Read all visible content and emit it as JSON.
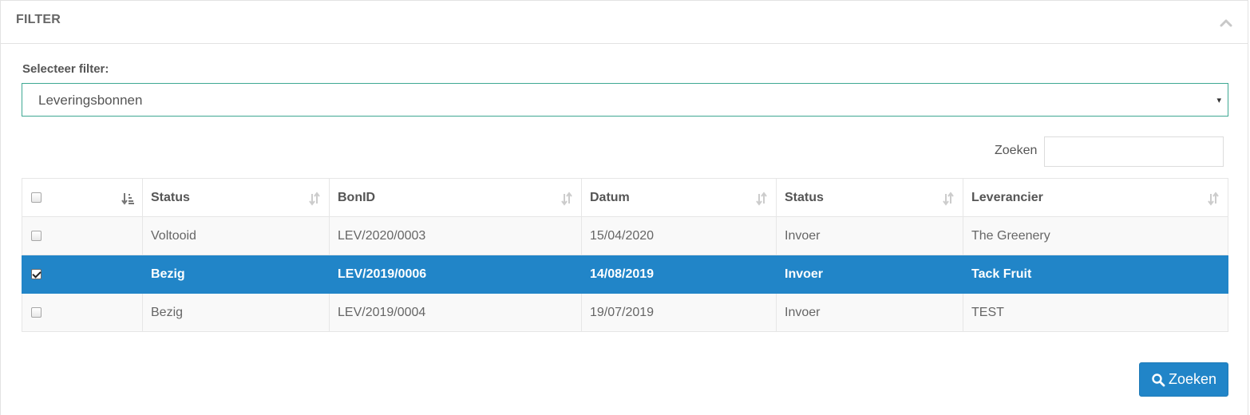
{
  "panel": {
    "title": "FILTER",
    "collapse_icon": "chevron-up-icon"
  },
  "filter": {
    "label": "Selecteer filter:",
    "selected": "Leveringsbonnen",
    "arrow": "▾"
  },
  "search": {
    "label": "Zoeken",
    "value": "",
    "placeholder": ""
  },
  "table": {
    "columns": [
      "",
      "Status",
      "BonID",
      "Datum",
      "Status",
      "Leverancier"
    ],
    "rows": [
      {
        "checked": false,
        "cells": [
          "Voltooid",
          "LEV/2020/0003",
          "15/04/2020",
          "Invoer",
          "The Greenery"
        ]
      },
      {
        "checked": true,
        "cells": [
          "Bezig",
          "LEV/2019/0006",
          "14/08/2019",
          "Invoer",
          "Tack Fruit"
        ]
      },
      {
        "checked": false,
        "cells": [
          "Bezig",
          "LEV/2019/0004",
          "19/07/2019",
          "Invoer",
          "TEST"
        ]
      }
    ]
  },
  "search_button": {
    "label": "Zoeken",
    "icon": "search-icon"
  },
  "colors": {
    "accent": "#2185c8",
    "select_border": "#3fa893"
  }
}
